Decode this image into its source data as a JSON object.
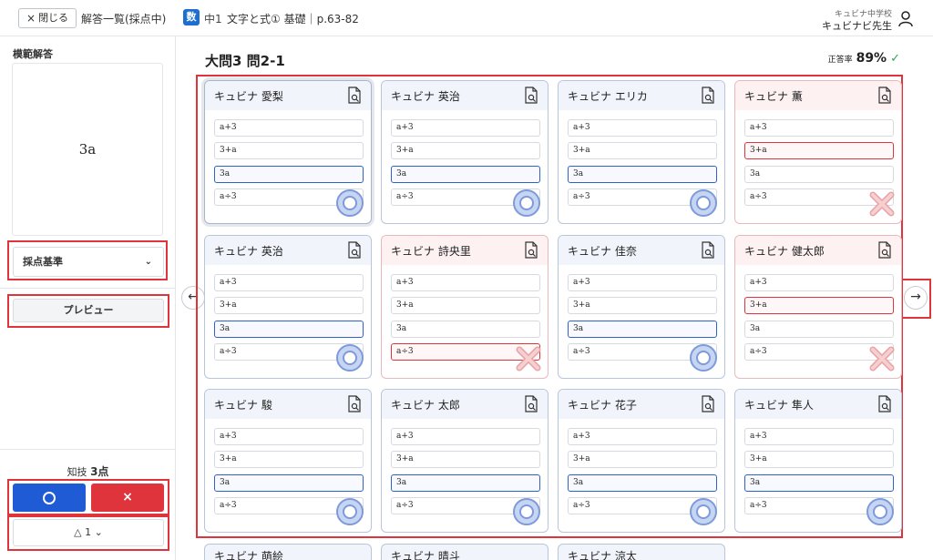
{
  "header": {
    "close_label": "閉じる",
    "list_label": "解答一覧(採点中)",
    "subject_badge": "数",
    "grade": "中1",
    "topic": "文字と式① 基礎｜p.63-82",
    "school": "キュビナ中学校",
    "teacher": "キュビナビ先生"
  },
  "sidebar": {
    "model_answer_title": "模範解答",
    "model_answer": "3a",
    "criteria_label": "採点基準",
    "preview_label": "プレビュー",
    "score_prefix": "知技",
    "score_value": "3点",
    "correct_mark": "○",
    "wrong_mark": "×",
    "partial_label": "△ 1"
  },
  "main": {
    "question_title": "大問3 問2-1",
    "accuracy_label": "正答率",
    "accuracy_value": "89%"
  },
  "options": [
    "a+3",
    "3+a",
    "3a",
    "a÷3"
  ],
  "students": [
    {
      "name": "キュビナ 愛梨",
      "selected": 2,
      "result": "correct"
    },
    {
      "name": "キュビナ 英治",
      "selected": 2,
      "result": "correct"
    },
    {
      "name": "キュビナ エリカ",
      "selected": 2,
      "result": "correct"
    },
    {
      "name": "キュビナ 薫",
      "selected": 1,
      "result": "wrong"
    },
    {
      "name": "キュビナ 英治",
      "selected": 2,
      "result": "correct"
    },
    {
      "name": "キュビナ 詩央里",
      "selected": 3,
      "result": "wrong"
    },
    {
      "name": "キュビナ 佳奈",
      "selected": 2,
      "result": "correct"
    },
    {
      "name": "キュビナ 健太郎",
      "selected": 1,
      "result": "wrong"
    },
    {
      "name": "キュビナ 駿",
      "selected": 2,
      "result": "correct"
    },
    {
      "name": "キュビナ 太郎",
      "selected": 2,
      "result": "correct"
    },
    {
      "name": "キュビナ 花子",
      "selected": 2,
      "result": "correct"
    },
    {
      "name": "キュビナ 隼人",
      "selected": 2,
      "result": "correct"
    }
  ],
  "partial_rows": [
    {
      "name": "キュビナ 萌絵"
    },
    {
      "name": "キュビナ 晴斗"
    },
    {
      "name": "キュビナ 涼太"
    }
  ]
}
